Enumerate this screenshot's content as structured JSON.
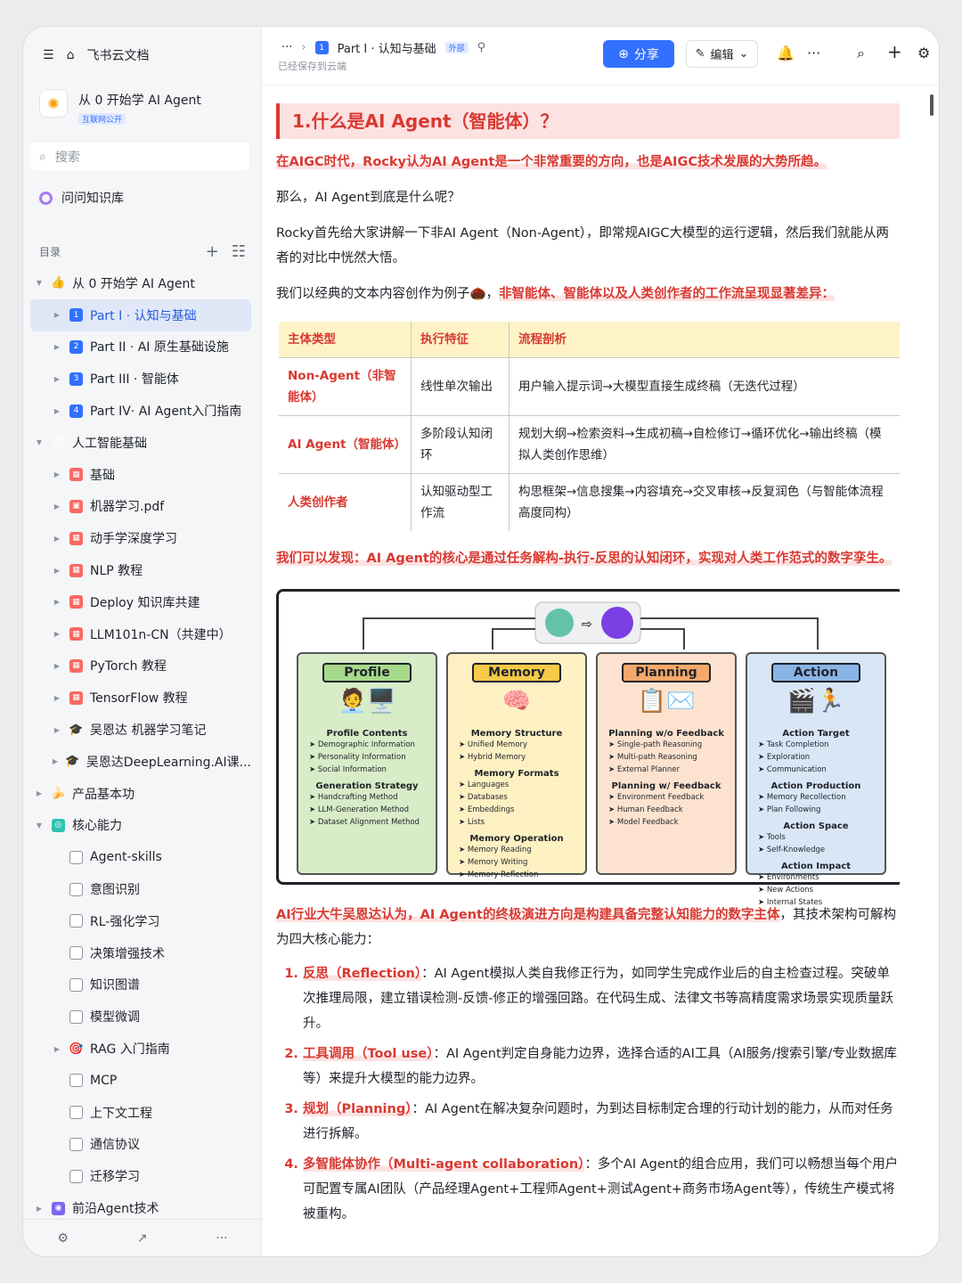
{
  "sidebar": {
    "app_name": "飞书云文档",
    "space": {
      "name": "从 0 开始学 AI Agent",
      "tag": "互联网公开"
    },
    "search_placeholder": "搜索",
    "ask": "问问知识库",
    "toc_label": "目录",
    "items": [
      {
        "label": "从 0 开始学 AI Agent",
        "level": 0,
        "expanded": true,
        "icon": "👍",
        "icon_color": ""
      },
      {
        "label": "Part I · 认知与基础",
        "level": 1,
        "active": true,
        "icon": "1",
        "icon_color": "#3370ff"
      },
      {
        "label": "Part II · AI 原生基础设施",
        "level": 1,
        "icon": "2",
        "icon_color": "#3370ff"
      },
      {
        "label": "Part III · 智能体",
        "level": 1,
        "icon": "3",
        "icon_color": "#3370ff"
      },
      {
        "label": "Part IV· AI Agent入门指南",
        "level": 1,
        "icon": "4",
        "icon_color": "#3370ff"
      },
      {
        "label": "人工智能基础",
        "level": 0,
        "expanded": true,
        "icon": "😍",
        "icon_color": ""
      },
      {
        "label": "基础",
        "level": 1,
        "icon": "▦",
        "icon_color": "#f76964"
      },
      {
        "label": "机器学习.pdf",
        "level": 1,
        "icon": "▣",
        "icon_color": "#f76964"
      },
      {
        "label": "动手学深度学习",
        "level": 1,
        "icon": "▦",
        "icon_color": "#f76964"
      },
      {
        "label": "NLP 教程",
        "level": 1,
        "icon": "▦",
        "icon_color": "#f76964"
      },
      {
        "label": "Deploy 知识库共建",
        "level": 1,
        "icon": "▦",
        "icon_color": "#f76964"
      },
      {
        "label": "LLM101n-CN（共建中）",
        "level": 1,
        "icon": "▦",
        "icon_color": "#f76964"
      },
      {
        "label": "PyTorch 教程",
        "level": 1,
        "icon": "▦",
        "icon_color": "#f76964"
      },
      {
        "label": "TensorFlow 教程",
        "level": 1,
        "icon": "▦",
        "icon_color": "#f76964"
      },
      {
        "label": "吴恩达 机器学习笔记",
        "level": 1,
        "icon": "🎓",
        "icon_color": ""
      },
      {
        "label": "吴恩达DeepLearning.AI课...",
        "level": 1,
        "icon": "🎓",
        "icon_color": ""
      },
      {
        "label": "产品基本功",
        "level": 0,
        "collapsed": true,
        "icon": "🍌",
        "icon_color": ""
      },
      {
        "label": "核心能力",
        "level": 0,
        "expanded": true,
        "icon": "◎",
        "icon_color": "#2fc2b0"
      },
      {
        "label": "Agent-skills",
        "level": 1,
        "icon": "doc",
        "icon_color": ""
      },
      {
        "label": "意图识别",
        "level": 1,
        "icon": "doc",
        "icon_color": ""
      },
      {
        "label": "RL-强化学习",
        "level": 1,
        "icon": "doc",
        "icon_color": ""
      },
      {
        "label": "决策增强技术",
        "level": 1,
        "icon": "doc",
        "icon_color": ""
      },
      {
        "label": "知识图谱",
        "level": 1,
        "icon": "doc",
        "icon_color": ""
      },
      {
        "label": "模型微调",
        "level": 1,
        "icon": "doc",
        "icon_color": ""
      },
      {
        "label": "RAG 入门指南",
        "level": 1,
        "icon": "🎯",
        "icon_color": ""
      },
      {
        "label": "MCP",
        "level": 1,
        "icon": "doc",
        "icon_color": ""
      },
      {
        "label": "上下文工程",
        "level": 1,
        "icon": "doc",
        "icon_color": ""
      },
      {
        "label": "通信协议",
        "level": 1,
        "icon": "doc",
        "icon_color": ""
      },
      {
        "label": "迁移学习",
        "level": 1,
        "icon": "doc",
        "icon_color": ""
      },
      {
        "label": "前沿Agent技术",
        "level": 0,
        "collapsed": true,
        "icon": "◉",
        "icon_color": "#7b67ee"
      }
    ]
  },
  "topbar": {
    "breadcrumb_more": "···",
    "doc_title": "Part I · 认知与基础",
    "external_tag": "外部",
    "saved": "已经保存到云端",
    "share": "分享",
    "edit": "编辑"
  },
  "doc": {
    "heading": "1.什么是AI Agent（智能体）？",
    "p1": "在AIGC时代，Rocky认为AI Agent是一个非常重要的方向，也是AIGC技术发展的大势所趋。",
    "p2": "那么，AI Agent到底是什么呢？",
    "p3": "Rocky首先给大家讲解一下非AI Agent（Non-Agent），即常规AIGC大模型的运行逻辑，然后我们就能从两者的对比中恍然大悟。",
    "p4_plain": "我们以经典的文本内容创作为例子🌰，",
    "p4_red": "非智能体、智能体以及人类创作者的工作流呈现显著差异：",
    "table": {
      "headers": [
        "主体类型",
        "执行特征",
        "流程剖析"
      ],
      "rows": [
        [
          "Non-Agent（非智能体）",
          "线性单次输出",
          "用户输入提示词→大模型直接生成终稿（无迭代过程）"
        ],
        [
          "AI Agent（智能体）",
          "多阶段认知闭环",
          "规划大纲→检索资料→生成初稿→自检修订→循环优化→输出终稿（模拟人类创作思维）"
        ],
        [
          "人类创作者",
          "认知驱动型工作流",
          "构思框架→信息搜集→内容填充→交叉审核→反复润色（与智能体流程高度同构）"
        ]
      ]
    },
    "p5": "我们可以发现：AI Agent的核心是通过任务解构-执行-反思的认知闭环，实现对人类工作范式的数字孪生。",
    "diagram": {
      "columns": [
        {
          "title": "Profile",
          "color": "#d7ecc7",
          "title_color": "#a6d98a",
          "pic": "🧑‍💼🖥️",
          "groups": [
            {
              "head": "Profile Contents",
              "items": [
                "Demographic Information",
                "Personality Information",
                "Social Information"
              ]
            },
            {
              "head": "Generation Strategy",
              "items": [
                "Handcrafting Method",
                "LLM-Generation Method",
                "Dataset Alignment Method"
              ]
            }
          ]
        },
        {
          "title": "Memory",
          "color": "#fdf0c2",
          "title_color": "#f7c948",
          "pic": "🧠",
          "groups": [
            {
              "head": "Memory Structure",
              "items": [
                "Unified Memory",
                "Hybrid Memory"
              ]
            },
            {
              "head": "Memory Formats",
              "items": [
                "Languages",
                "Databases",
                "Embeddings",
                "Lists"
              ]
            },
            {
              "head": "Memory Operation",
              "items": [
                "Memory Reading",
                "Memory Writing",
                "Memory Reflection"
              ]
            }
          ]
        },
        {
          "title": "Planning",
          "color": "#fde3cf",
          "title_color": "#f6a86a",
          "pic": "📋✉️",
          "groups": [
            {
              "head": "Planning w/o Feedback",
              "items": [
                "Single-path Reasoning",
                "Multi-path Reasoning",
                "External Planner"
              ]
            },
            {
              "head": "Planning w/ Feedback",
              "items": [
                "Environment Feedback",
                "Human Feedback",
                "Model Feedback"
              ]
            }
          ]
        },
        {
          "title": "Action",
          "color": "#d8e6f6",
          "title_color": "#8ab4e6",
          "pic": "🎬🏃",
          "groups": [
            {
              "head": "Action Target",
              "items": [
                "Task Completion",
                "Exploration",
                "Communication"
              ]
            },
            {
              "head": "Action Production",
              "items": [
                "Memory Recollection",
                "Plan Following"
              ]
            },
            {
              "head": "Action Space",
              "items": [
                "Tools",
                "Self-Knowledge"
              ]
            },
            {
              "head": "Action Impact",
              "items": [
                "Environments",
                "New Actions",
                "Internal States"
              ]
            }
          ]
        }
      ]
    },
    "p6_red": "AI行业大牛吴恩达认为，AI Agent的终极演进方向是构建具备完整认知能力的数字主体",
    "p6_plain": "，其技术架构可解构为四大核心能力：",
    "list": [
      {
        "k": "反思（Reflection）",
        "v": "：AI Agent模拟人类自我修正行为，如同学生完成作业后的自主检查过程。突破单次推理局限，建立错误检测-反馈-修正的增强回路。在代码生成、法律文书等高精度需求场景实现质量跃升。"
      },
      {
        "k": "工具调用（Tool use）",
        "v": "：AI Agent判定自身能力边界，选择合适的AI工具（AI服务/搜索引擎/专业数据库等）来提升大模型的能力边界。"
      },
      {
        "k": "规划（Planning）",
        "v": "：AI Agent在解决复杂问题时，为到达目标制定合理的行动计划的能力，从而对任务进行拆解。"
      },
      {
        "k": "多智能体协作（Multi-agent collaboration）",
        "v": "：多个AI Agent的组合应用，我们可以畅想当每个用户可配置专属AI团队（产品经理Agent+工程师Agent+测试Agent+商务市场Agent等），传统生产模式将被重构。"
      }
    ]
  }
}
